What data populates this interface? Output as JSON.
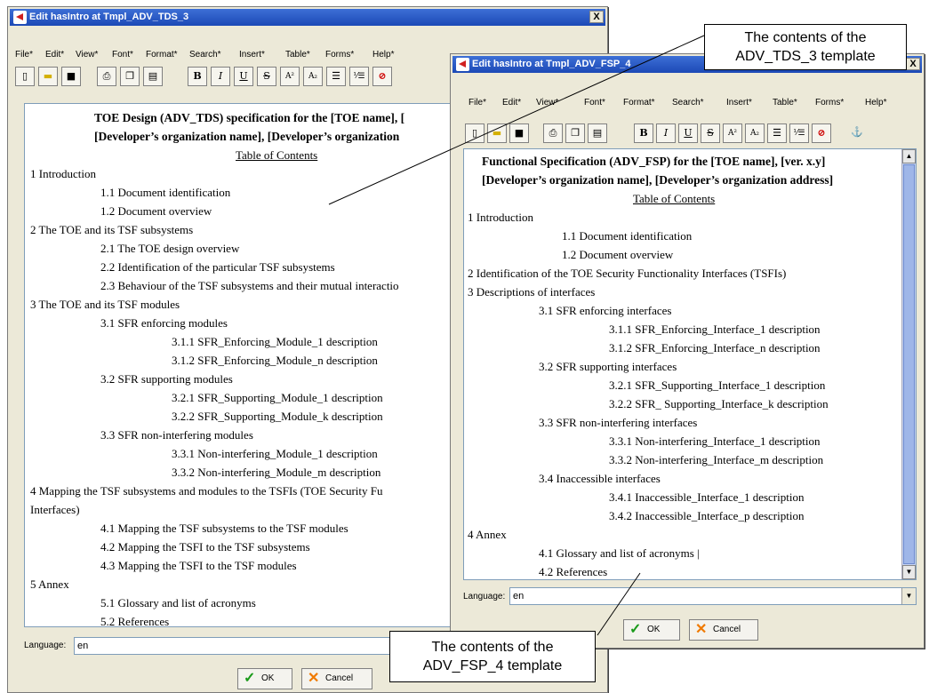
{
  "menu_items": [
    "File*",
    "Edit*",
    "View*",
    "Font*",
    "Format*",
    "Search*",
    "Insert*",
    "Table*",
    "Forms*",
    "Help*"
  ],
  "window_left": {
    "title": "Edit hasIntro at Tmpl_ADV_TDS_3",
    "close_label": "X",
    "lines": [
      "TOE Design (ADV_TDS) specification for the [TOE name], [",
      "[Developer’s organization name], [Developer’s organization",
      "Table of Contents",
      "1 Introduction",
      "1.1 Document identification",
      "1.2 Document overview",
      "2 The TOE and its TSF subsystems",
      "2.1 The TOE design overview",
      "2.2 Identification of the particular TSF subsystems",
      "2.3 Behaviour of the TSF subsystems and their mutual interactio",
      "3 The TOE and its TSF modules",
      "3.1 SFR enforcing modules",
      "3.1.1 SFR_Enforcing_Module_1 description",
      "3.1.2 SFR_Enforcing_Module_n description",
      "3.2 SFR supporting modules",
      "3.2.1 SFR_Supporting_Module_1 description",
      "3.2.2 SFR_Supporting_Module_k description",
      "3.3 SFR non-interfering modules",
      "3.3.1 Non-interfering_Module_1 description",
      "3.3.2 Non-interfering_Module_m description",
      "4 Mapping the TSF subsystems and modules to the TSFIs (TOE Security Fu",
      "Interfaces)",
      "4.1 Mapping the TSF subsystems to the TSF modules",
      "4.2 Mapping the TSFI to the TSF subsystems",
      "4.3 Mapping the TSFI to the TSF modules",
      "5 Annex",
      "5.1 Glossary and list of acronyms",
      "5.2 References"
    ],
    "language_label": "Language:",
    "language_value": "en",
    "ok_label": "OK",
    "cancel_label": "Cancel"
  },
  "window_right": {
    "title": "Edit hasIntro at Tmpl_ADV_FSP_4",
    "close_label": "X",
    "lines": [
      "Functional Specification (ADV_FSP) for the [TOE name], [ver. x.y]",
      "[Developer’s organization name], [Developer’s organization address]",
      "Table of Contents",
      "1 Introduction",
      "1.1 Document identification",
      "1.2 Document overview",
      "2 Identification of the TOE Security Functionality Interfaces (TSFIs)",
      "3 Descriptions of interfaces",
      "3.1 SFR enforcing interfaces",
      "3.1.1 SFR_Enforcing_Interface_1 description",
      "3.1.2 SFR_Enforcing_Interface_n description",
      "3.2 SFR supporting interfaces",
      "3.2.1 SFR_Supporting_Interface_1 description",
      "3.2.2 SFR_ Supporting_Interface_k description",
      "3.3 SFR non-interfering interfaces",
      "3.3.1 Non-interfering_Interface_1 description",
      "3.3.2 Non-interfering_Interface_m description",
      "3.4 Inaccessible interfaces",
      "3.4.1 Inaccessible_Interface_1 description",
      "3.4.2 Inaccessible_Interface_p description",
      "4 Annex",
      "4.1 Glossary and list of acronyms |",
      "4.2 References"
    ],
    "language_label": "Language:",
    "language_value": "en",
    "ok_label": "OK",
    "cancel_label": "Cancel"
  },
  "toolbar_glyphs": {
    "bold": "B",
    "italic": "I",
    "underline": "U",
    "strike": "S",
    "superscript": "A²",
    "subscript": "A₂",
    "bullets": "☰",
    "numbering": "⅟☰",
    "no_format": "⊘",
    "anchor": "⚓",
    "new_doc": "▯",
    "open": "▬",
    "save": "■",
    "print": "⎙",
    "copy": "❐",
    "paste": "▤"
  },
  "callouts": {
    "top": [
      "The contents of the",
      "ADV_TDS_3 template"
    ],
    "bottom": [
      "The contents of the",
      "ADV_FSP_4 template"
    ]
  },
  "colors": {
    "titlebar": "#2456c4",
    "scroll_track": "#c7d4f2",
    "ok_check": "#1a9a1a",
    "cancel_x": "#f07a00"
  }
}
